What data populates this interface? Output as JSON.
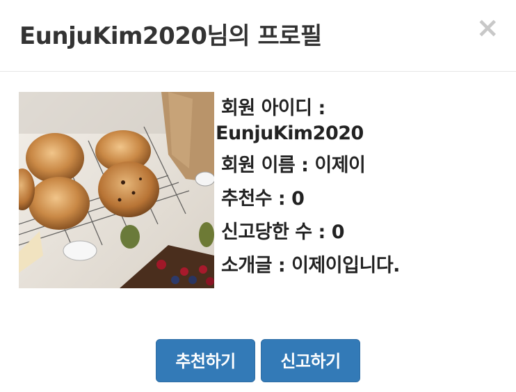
{
  "modal": {
    "title": "EunjuKim2020님의 프로필",
    "close_symbol": "×"
  },
  "profile": {
    "image_description": "bagels on cooling rack",
    "id_label": "회원 아이디 :",
    "id_value": "EunjuKim2020",
    "name_line": "회원 이름 : 이제이",
    "recommend_line": "추천수 : 0",
    "report_line": "신고당한 수 : 0",
    "intro_line": "소개글 : 이제이입니다."
  },
  "buttons": {
    "recommend_label": "추천하기",
    "report_label": "신고하기"
  },
  "colors": {
    "button_bg": "#337ab7",
    "title_text": "#333333",
    "close_icon": "#c8c8c8"
  }
}
